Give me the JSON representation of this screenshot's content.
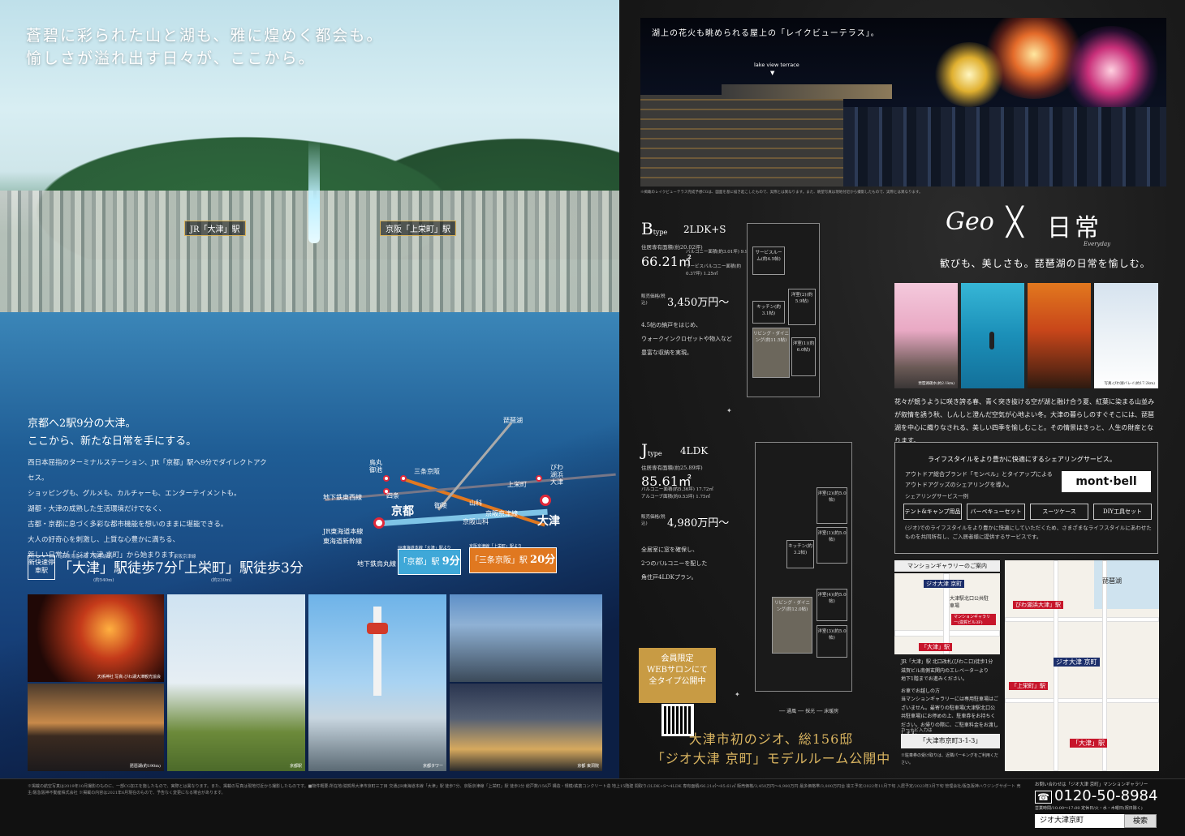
{
  "left": {
    "headline": [
      "蒼碧に彩られた山と湖も、雅に煌めく都会も。",
      "愉しさが溢れ出す日々が、ここから。"
    ],
    "labels": {
      "jr_otsu": "JR「大津」駅",
      "keihan": "京阪「上栄町」駅"
    },
    "lead": [
      "京都へ2駅9分の大津。",
      "ここから、新たな日常を手にする。"
    ],
    "body": [
      "西日本屈指のターミナルステーション、JR「京都」駅へ9分でダイレクトアクセス。",
      "ショッピングも、グルメも、カルチャーも、エンターテイメントも。",
      "湖都・大津の成熟した生活環境だけでなく、",
      "古都・京都に息づく多彩な都市機能を想いのままに堪能できる。",
      "大人の好奇心を刺激し、上質な心豊かに満ちる、",
      "新しい日常が「ジオ大津 京町」から始まります。"
    ],
    "rapid_badge": "新快速停車駅",
    "walk1": {
      "station": "「大津」",
      "text": "駅徒歩7分",
      "note": "(約540m)"
    },
    "walk2": {
      "station": "「上栄町」",
      "text": "駅徒歩3分",
      "note": "(約230m)"
    },
    "walk1_prefix": "JR東海道本線「琵琶湖線」",
    "walk2_prefix": "京阪京津線",
    "map": {
      "kyoto": "京都",
      "otsu": "大津",
      "sanjo": "三条京阪",
      "lake": "琵琶湖",
      "kamisakae": "上栄町",
      "shijo": "四条",
      "karasuma": "鳥丸御池",
      "yamashina": "山科",
      "keihan_yamashina": "京阪山科",
      "misasagi": "御陵",
      "biwako_hamaotsu": "びわ湖浜大津",
      "keishin": "京阪京津線",
      "subway_tozai": "地下鉄東西線",
      "jr_tokaido": "JR東海道本線",
      "tokaido_shinkansen": "東海道新幹線",
      "subway_karasuma": "地下鉄烏丸線"
    },
    "badge_kyoto": {
      "name": "「京都」駅",
      "time": "9分"
    },
    "badge_sanjo": {
      "name": "「三条京阪」駅",
      "time": "20分"
    },
    "badge_note_kyoto": "JR東海道本線「大津」駅より",
    "badge_note_sanjo": "京阪京津線「上栄町」駅より",
    "photo_caps": [
      "天孫神社 写真:びわ湖大津観光協会",
      "琵琶湖(約190m)",
      "京都駅",
      "京都タワー",
      "京都 東洞院"
    ]
  },
  "right": {
    "hero_caption": "湖上の花火も眺められる屋上の「レイクビューテラス」。",
    "hero_lake": "lake view terrace",
    "hero_arrow": "▼",
    "hero_note": "※掲載のレイクビューテラス完成予想CGは、図面を基に描き起こしたもので、実際とは異なります。また、眺望写真は現地付近から撮影したもので、実際とは異なります。",
    "b": {
      "type": "B",
      "type_word": "type",
      "layout": "2LDK+S",
      "area_label": "住居専有面積(約20.02坪)",
      "area": "66.21㎡",
      "sub1": "バルコニー面積(約3.01坪) 9.96㎡",
      "sub2": "サービスバルコニー面積(約0.37坪) 1.25㎡",
      "price_label": "販売価格(税込)",
      "price": "3,450万円〜",
      "desc": [
        "4.5帖の納戸をはじめ、",
        "ウォークインクロゼットや物入など",
        "豊富な収納を実現。"
      ],
      "rooms": [
        "サービスルーム(約4.5帖)",
        "キッチン(約3.1帖)",
        "洋室(2)(約5.9帖)",
        "リビング・ダイニング(約11.5帖)",
        "洋室(1)(約6.0帖)"
      ]
    },
    "j": {
      "type": "J",
      "type_word": "type",
      "layout": "4LDK",
      "area_label": "住居専有面積(約25.89坪)",
      "area": "85.61㎡",
      "sub1": "バルコニー面積(約5.36坪) 17.72㎡",
      "sub2": "アルコーブ面積(約0.53坪) 1.75㎡",
      "price_label": "販売価格(税込)",
      "price": "4,980万円〜",
      "desc": [
        "全居室に窓を確保し、",
        "2つのバルコニーを配した",
        "角住戸4LDKプラン。"
      ],
      "rooms": [
        "洋室(2)(約5.0帖)",
        "洋室(1)(約5.0帖)",
        "キッチン(約3.2帖)",
        "洋室(4)(約5.0帖)",
        "リビング・ダイニング(約12.0帖)",
        "洋室(3)(約5.0帖)"
      ]
    },
    "geo": "Geo",
    "cross": "╳",
    "nichijo": "日常",
    "everyday": "Everyday",
    "tagline": "歓びも、美しさも。琵琶湖の日常を愉しむ。",
    "season_caps": [
      "琵琶湖疏水(約2.1km)",
      "",
      "",
      "写真:びわ湖バレイ(約17.2km)"
    ],
    "season_text": "花々が競うように咲き誇る春、青く突き抜ける空が湖と融け合う夏、紅葉に染まる山並みが叙情を誘う秋、しんしと澄んだ空気が心地よい冬。大津の暮らしのすぐそこには、琵琶湖を中心に織りなされる、美しい四季を愉しむこと。その情景はきっと、人生の財産となります。",
    "share": {
      "title": "ライフスタイルをより豊かに快適にするシェアリングサービス。",
      "desc": [
        "アウトドア総合ブランド「モンベル」とタイアップによる",
        "アウトドアグッズのシェアリングを導入。"
      ],
      "logo": "mont·bell",
      "label": "シェアリングサービス一例",
      "items": [
        "テント&キャンプ用品",
        "バーベキューセット",
        "スーツケース",
        "DIY工具セット"
      ],
      "foot": "(ジオ)でのライフスタイルをより豊かに快適にしていただくため、さまざまなライフスタイルにあわせたものを共同所有し、ご入居者様に提供するサービスです。"
    },
    "gallery_head": "マンションギャラリーのご案内",
    "gal_map1": {
      "station": "「大津」駅",
      "label1": "ジオ大津 京町",
      "label2": "大津駅北口公共駐車場",
      "label3": "マンションギャラリー(滋賀ビル3F)"
    },
    "gal_map2": {
      "lake": "琵琶湖",
      "s1": "びわ湖浜大津」駅",
      "s2": "ジオ大津 京町",
      "s3": "「上栄町」駅",
      "s4": "「大津」駅"
    },
    "gal_text": [
      "JR「大津」駅 北口改札(びわこ口)徒歩1分",
      "滋賀ビル南側玄関内のエレベーターより",
      "地下1階までお進みください。",
      "",
      "お車でお越しの方",
      "当マンションギャラリーには専用駐車場はございません。最寄りの駐車場(大津駅北口公共駐車場)にお停めの上、駐車券をお持ちください。お帰りの際に、ご駐車料金をお渡しします。"
    ],
    "gal_nav_label": "カーナビ入力は",
    "gal_addr": "「大津市京町3-1-3」",
    "gal_foot": "※駐車券の受け取りは、近隣パーキングをご利用ください。",
    "member": [
      "会員限定",
      "WEBサロンにて",
      "全タイプ公開中"
    ],
    "legend": "── 通風 ── 採光 ── 床暖房",
    "cta": [
      "大津市初のジオ、総156邸",
      "「ジオ大津 京町」モデルルーム公開中"
    ]
  },
  "footer": {
    "fine": "※掲載の航空写真は2019年10月撮影のものに、一部CG加工を施したもので、実際とは異なります。また、掲載の写真は現地付近から撮影したものです。■物件概要:所在地/滋賀県大津市京町三丁目 交通/JR東海道本線「大津」駅 徒歩7分、京阪京津線「上栄町」駅 徒歩3分 総戸数/156戸 構造・規模/鉄筋コンクリート造 地上15階建 間取り/2LDK+S〜4LDK 専有面積/66.21㎡〜85.61㎡ 販売価格/3,450万円〜4,980万円 最多価格帯/3,800万円台 竣工予定/2022年11月下旬 入居予定/2023年3月下旬 管理会社/阪急阪神ハウジングサポート 売主/阪急阪神不動産株式会社 ※掲載の内容は2021年6月現在のもので、予告なく変更になる場合があります。",
    "contact_label": "お問い合わせは「ジオ大津 京町」マンションギャラリー",
    "tel": "0120-50-8984",
    "tel_note": "営業時間/10:00〜17:00 定休日/火・水・木曜日(祝日除く)",
    "search": "ジオ大津京町",
    "search_btn": "検索"
  }
}
